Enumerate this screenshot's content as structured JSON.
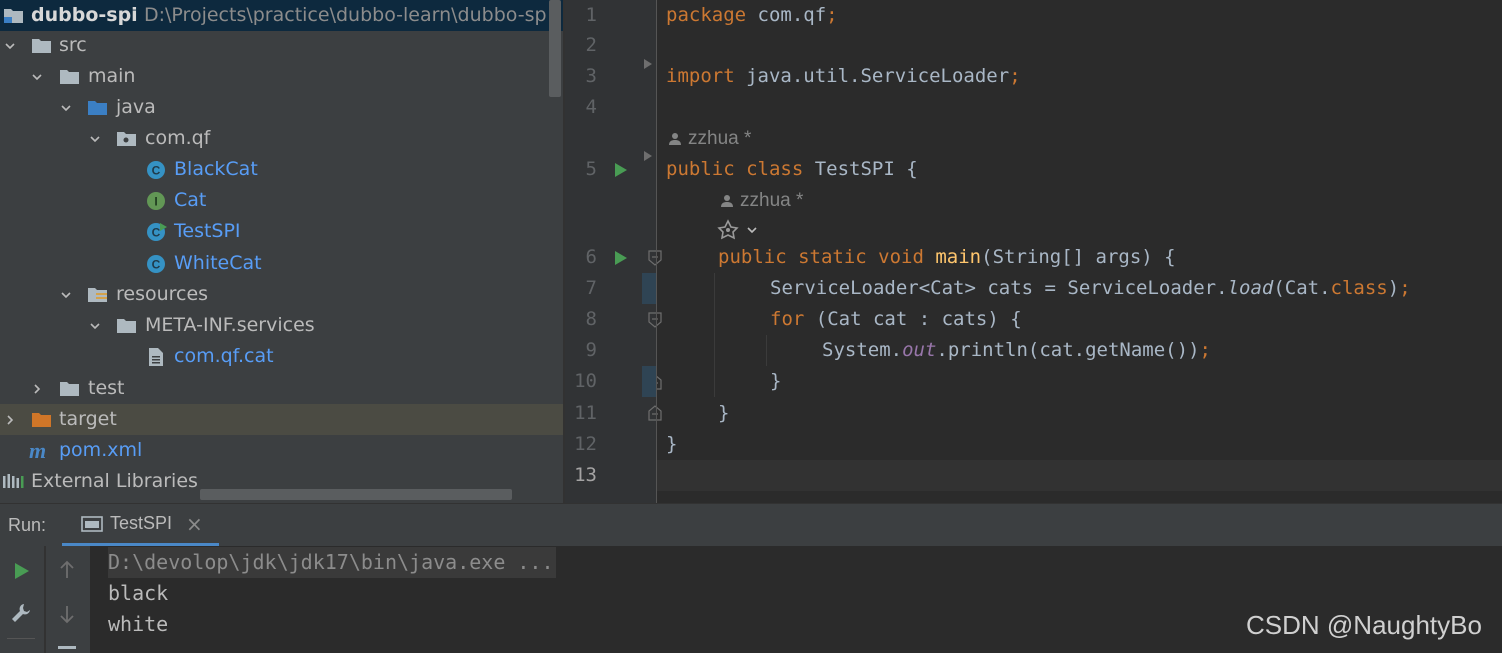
{
  "project": {
    "root_name": "dubbo-spi",
    "root_path": "D:\\Projects\\practice\\dubbo-learn\\dubbo-sp",
    "items": [
      {
        "label": "src"
      },
      {
        "label": "main"
      },
      {
        "label": "java"
      },
      {
        "label": "com.qf"
      },
      {
        "label": "BlackCat"
      },
      {
        "label": "Cat"
      },
      {
        "label": "TestSPI"
      },
      {
        "label": "WhiteCat"
      },
      {
        "label": "resources"
      },
      {
        "label": "META-INF.services"
      },
      {
        "label": "com.qf.cat"
      },
      {
        "label": "test"
      },
      {
        "label": "target"
      },
      {
        "label": "pom.xml"
      },
      {
        "label": "External Libraries"
      }
    ],
    "badges": {
      "class": "C",
      "interface": "I",
      "maven": "m"
    }
  },
  "editor": {
    "line_numbers": [
      "1",
      "2",
      "3",
      "4",
      "5",
      "6",
      "7",
      "8",
      "9",
      "10",
      "11",
      "12",
      "13"
    ],
    "author_hint": "zzhua *",
    "lines": {
      "l1_kw": "package",
      "l1_rest": " com.qf",
      "l1_semi": ";",
      "l3_kw": "import",
      "l3_rest": " java.util.ServiceLoader",
      "l3_semi": ";",
      "l5_kw": "public class",
      "l5_rest": " TestSPI {",
      "l6_kw": "public static void",
      "l6_fn": "main",
      "l6_rest": "(String[] args) {",
      "l7_a": "ServiceLoader<Cat> cats = ServiceLoader.",
      "l7_load": "load",
      "l7_b": "(Cat.",
      "l7_kw": "class",
      "l7_c": ")",
      "l7_semi": ";",
      "l8_kw": "for",
      "l8_rest": " (Cat cat : cats) {",
      "l9_a": "System.",
      "l9_out": "out",
      "l9_b": ".println(cat.getName())",
      "l9_semi": ";",
      "l10": "}",
      "l11": "}",
      "l12": "}"
    }
  },
  "run": {
    "label": "Run:",
    "tab_label": "TestSPI",
    "close_glyph": "×"
  },
  "console": {
    "lines": [
      "D:\\devolop\\jdk\\jdk17\\bin\\java.exe ...",
      "black",
      "white"
    ]
  },
  "watermark": "CSDN @NaughtyBo",
  "colors": {
    "keyword": "#cc7832",
    "method": "#ffc66d",
    "static_field": "#9876aa",
    "run_green": "#499c54",
    "tab_underline": "#4a88c7"
  }
}
